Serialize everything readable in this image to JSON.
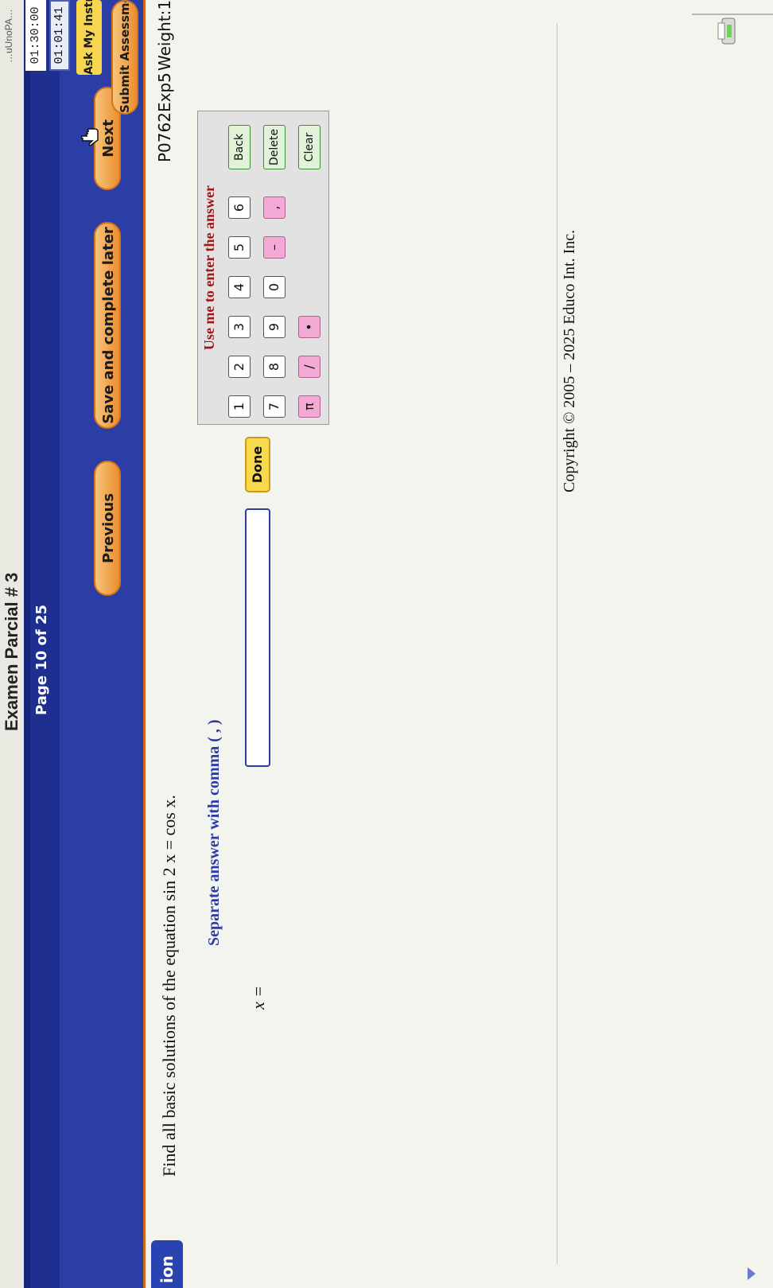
{
  "header": {
    "exam_title": "Examen Parcial # 3",
    "top_right_caption": "…uUnoPA…"
  },
  "nav": {
    "page_indicator": "Page 10 of 25",
    "previous_label": "Previous",
    "save_label": "Save and complete later",
    "next_label": "Next"
  },
  "timers": {
    "total": "01:30:00",
    "remaining": "01:01:41"
  },
  "right_panel": {
    "ask_label": "Ask My Instructor",
    "submit_label": "Submit Assessment"
  },
  "left_tab": {
    "label": "ion"
  },
  "problem": {
    "id": "P0762Exp5",
    "weight": "Weight:1",
    "question": "Find all basic solutions of the equation sin 2 x = cos x.",
    "instruction": "Separate answer with comma ( , )",
    "variable_label": "x =",
    "answer_value": "",
    "done_label": "Done"
  },
  "keypad": {
    "title": "Use me to enter the answer",
    "keys": [
      {
        "label": "1",
        "type": "digit"
      },
      {
        "label": "2",
        "type": "digit"
      },
      {
        "label": "3",
        "type": "digit"
      },
      {
        "label": "4",
        "type": "digit"
      },
      {
        "label": "5",
        "type": "digit"
      },
      {
        "label": "6",
        "type": "digit"
      },
      {
        "label": "Back",
        "type": "action"
      },
      {
        "label": "7",
        "type": "digit"
      },
      {
        "label": "8",
        "type": "digit"
      },
      {
        "label": "9",
        "type": "digit"
      },
      {
        "label": "0",
        "type": "digit"
      },
      {
        "label": "–",
        "type": "symbol"
      },
      {
        "label": ",",
        "type": "symbol"
      },
      {
        "label": "Delete",
        "type": "action"
      },
      {
        "label": "π",
        "type": "symbol"
      },
      {
        "label": "/",
        "type": "symbol"
      },
      {
        "label": "•",
        "type": "symbol"
      },
      {
        "label": "Clear",
        "type": "action"
      }
    ]
  },
  "footer": {
    "copyright": "Copyright © 2005 – 2025 Educo Int. Inc."
  },
  "colors": {
    "nav_blue": "#1f2f8f",
    "button_orange": "#eb8d2e",
    "done_yellow": "#f8d94d",
    "instruction_blue": "#2c3aa8",
    "keypad_title_red": "#a01616",
    "pink_key": "#f2a9d3"
  },
  "icons": [
    "hand-pointer-icon",
    "printer-tray-icon",
    "scroll-down-arrow-icon"
  ]
}
